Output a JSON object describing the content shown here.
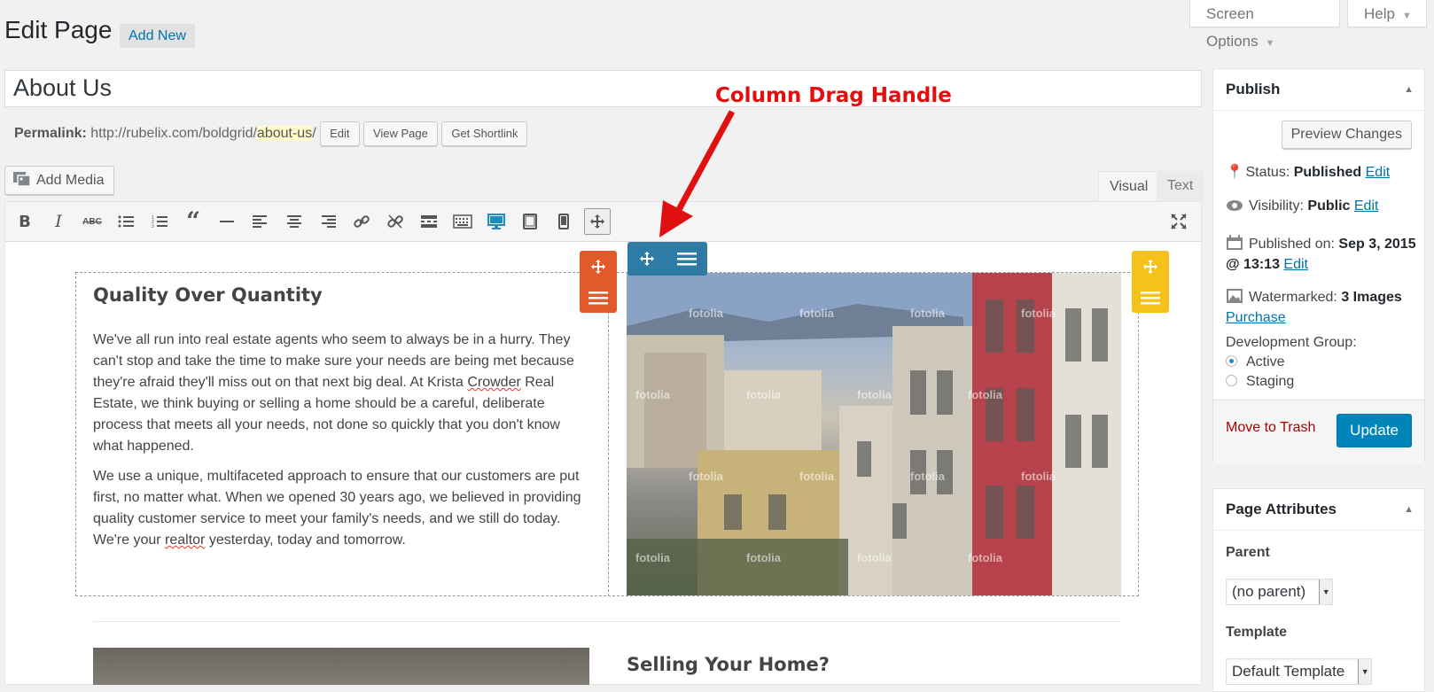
{
  "top_tabs": {
    "screen_options": "Screen Options",
    "help": "Help"
  },
  "page": {
    "title": "Edit Page",
    "add_new": "Add New"
  },
  "post": {
    "title": "About Us",
    "permalink_label": "Permalink:",
    "permalink_base": "http://rubelix.com/boldgrid/",
    "permalink_slug": "about-us",
    "permalink_tail": "/",
    "edit_btn": "Edit",
    "view_btn": "View Page",
    "shortlink_btn": "Get Shortlink"
  },
  "editor": {
    "add_media": "Add Media",
    "tab_visual": "Visual",
    "tab_text": "Text",
    "toolbar_icons": [
      "bold-icon",
      "italic-icon",
      "strikethrough-icon",
      "bullet-list-icon",
      "numbered-list-icon",
      "blockquote-icon",
      "horizontal-rule-icon",
      "align-left-icon",
      "align-center-icon",
      "align-right-icon",
      "link-icon",
      "unlink-icon",
      "read-more-icon",
      "toolbar-toggle-icon",
      "desktop-preview-icon",
      "tablet-preview-icon",
      "mobile-preview-icon",
      "move-icon"
    ]
  },
  "content": {
    "heading": "Quality Over Quantity",
    "para1_a": "We've all run into real estate agents who seem to always be in a hurry. They can't stop and take the time to make sure your needs are being met because they're afraid they'll miss out on that next big deal. At Krista ",
    "para1_b": "Crowder",
    "para1_c": " Real Estate, we think buying or selling a home should be a careful, deliberate process that meets all your needs, not done so quickly that you don't know what happened.",
    "para2_a": "We use a unique, multifaceted approach to ensure that our customers are put first, no matter what. When we opened 30 years ago, we believed in providing quality customer service to meet your family's needs, and we still do today. We're your ",
    "para2_b": "realtor",
    "para2_c": " yesterday, today and tomorrow.",
    "watermark": "fotolia",
    "heading2": "Selling Your Home?"
  },
  "annotation": {
    "label": "Column Drag Handle",
    "color": "#e01010"
  },
  "handle_colors": {
    "row": "#e2592a",
    "column": "#2e7ba6",
    "image": "#f5c21b"
  },
  "publish": {
    "title": "Publish",
    "preview": "Preview Changes",
    "status_label": "Status:",
    "status_value": "Published",
    "visibility_label": "Visibility:",
    "visibility_value": "Public",
    "published_label": "Published on:",
    "published_value_line1": "Sep 3, 2015",
    "published_value_line2": "@ 13:13",
    "watermarked_label": "Watermarked:",
    "watermarked_value": "3 Images",
    "purchase": "Purchase",
    "dev_group_label": "Development Group:",
    "dev_active": "Active",
    "dev_staging": "Staging",
    "edit_link": "Edit",
    "trash": "Move to Trash",
    "update": "Update"
  },
  "attributes": {
    "title": "Page Attributes",
    "parent_label": "Parent",
    "parent_value": "(no parent)",
    "template_label": "Template",
    "template_value": "Default Template"
  }
}
